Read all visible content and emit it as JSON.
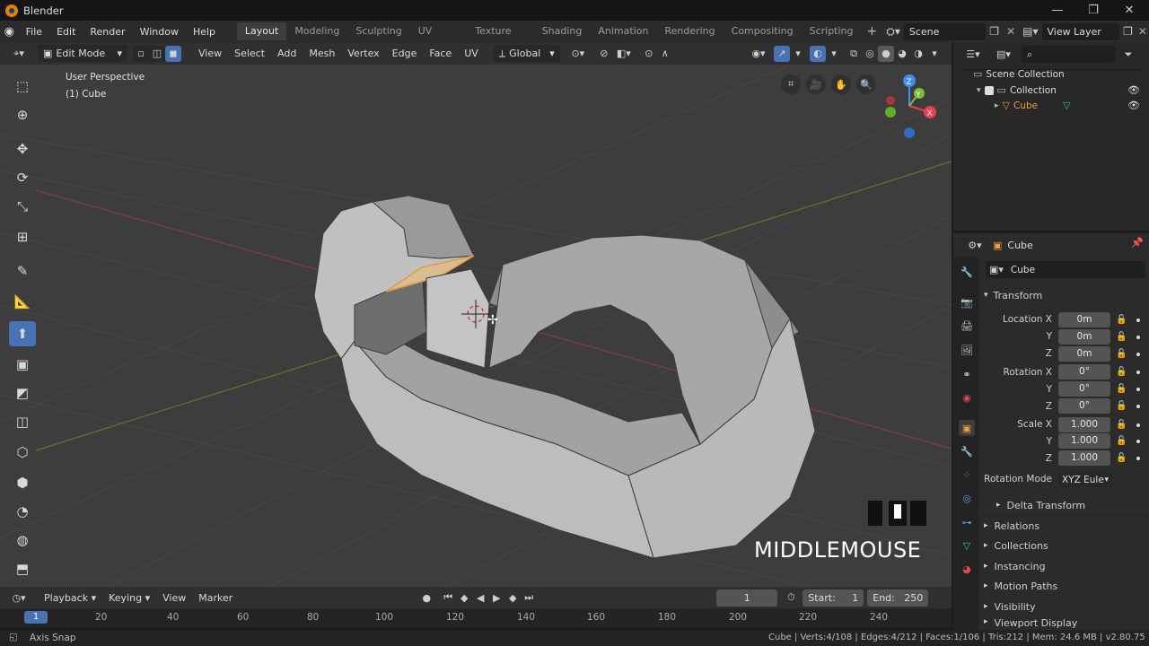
{
  "app": {
    "title": "Blender"
  },
  "menu": {
    "items": [
      "File",
      "Edit",
      "Render",
      "Window",
      "Help"
    ]
  },
  "workspaces": [
    "Layout",
    "Modeling",
    "Sculpting",
    "UV Editing",
    "Texture Paint",
    "Shading",
    "Animation",
    "Rendering",
    "Compositing",
    "Scripting"
  ],
  "active_workspace": "Layout",
  "scene": {
    "name": "Scene"
  },
  "view_layer": {
    "name": "View Layer"
  },
  "header": {
    "mode": "Edit Mode",
    "menus": [
      "View",
      "Select",
      "Add",
      "Mesh",
      "Vertex",
      "Edge",
      "Face",
      "UV"
    ],
    "orientation": "Global"
  },
  "viewport": {
    "perspective_label": "User Perspective",
    "object_label": "(1) Cube",
    "overlay_text": "MIDDLEMOUSE",
    "gizmo_axis_z": "Z",
    "gizmo_axis_y": "Y",
    "gizmo_axis_x": "X"
  },
  "outliner": {
    "root": "Scene Collection",
    "collection": "Collection",
    "object": "Cube"
  },
  "properties": {
    "object_name": "Cube",
    "datablock_name": "Cube",
    "transform_title": "Transform",
    "location_label": "Location X",
    "rotation_label": "Rotation X",
    "scale_label": "Scale X",
    "y": "Y",
    "z": "Z",
    "location": [
      "0m",
      "0m",
      "0m"
    ],
    "rotation": [
      "0°",
      "0°",
      "0°"
    ],
    "scale": [
      "1.000",
      "1.000",
      "1.000"
    ],
    "rotation_mode_label": "Rotation Mode",
    "rotation_mode": "XYZ Eule",
    "delta_transform": "Delta Transform",
    "panels": [
      "Relations",
      "Collections",
      "Instancing",
      "Motion Paths",
      "Visibility",
      "Viewport Display"
    ]
  },
  "timeline": {
    "menus": [
      "Playback",
      "Keying",
      "View",
      "Marker"
    ],
    "current_frame": "1",
    "start_label": "Start:",
    "start": "1",
    "end_label": "End:",
    "end": "250",
    "ticks": [
      "20",
      "40",
      "60",
      "80",
      "100",
      "120",
      "140",
      "160",
      "180",
      "200",
      "220",
      "240"
    ],
    "frame_indicator": "1"
  },
  "status": {
    "left": "Axis Snap",
    "right": "Cube | Verts:4/108 | Edges:4/212 | Faces:1/106 | Tris:212 | Mem: 24.6 MB | v2.80.75"
  },
  "colors": {
    "accent": "#4772b3",
    "active_object": "#e8a13a",
    "x_axis": "#e8404e",
    "y_axis": "#7dbf3a",
    "z_axis": "#3f8ef0"
  }
}
